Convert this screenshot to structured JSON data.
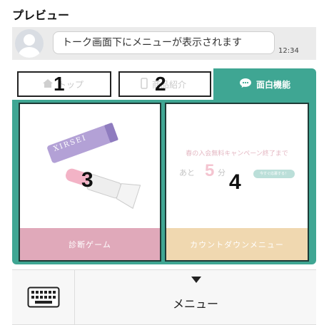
{
  "preview": {
    "title": "プレビュー"
  },
  "chat": {
    "message": "トーク画面下にメニューが表示されます",
    "time": "12:34"
  },
  "tabs": [
    {
      "label": "トップ",
      "icon": "home-icon",
      "number": "1"
    },
    {
      "label": "商品紹介",
      "icon": "smartphone-icon",
      "number": "2"
    },
    {
      "label": "面白機能",
      "icon": "chat-bubble-icon",
      "active": true
    }
  ],
  "cards": [
    {
      "label": "診断ゲーム",
      "number": "3",
      "brand": "XIRSEI"
    },
    {
      "label": "カウントダウンメニュー",
      "number": "4",
      "promo_title": "春の入会無料キャンペーン終了まで",
      "promo_prefix": "あと",
      "promo_value": "5",
      "promo_unit": "分",
      "promo_button": "今すぐ応募する！"
    }
  ],
  "bottom": {
    "menu_label": "メニュー",
    "keyboard_icon": "keyboard-icon"
  },
  "colors": {
    "accent": "#3fa693",
    "card_pink": "#e0a9ba",
    "card_beige": "#f0d8b0"
  }
}
